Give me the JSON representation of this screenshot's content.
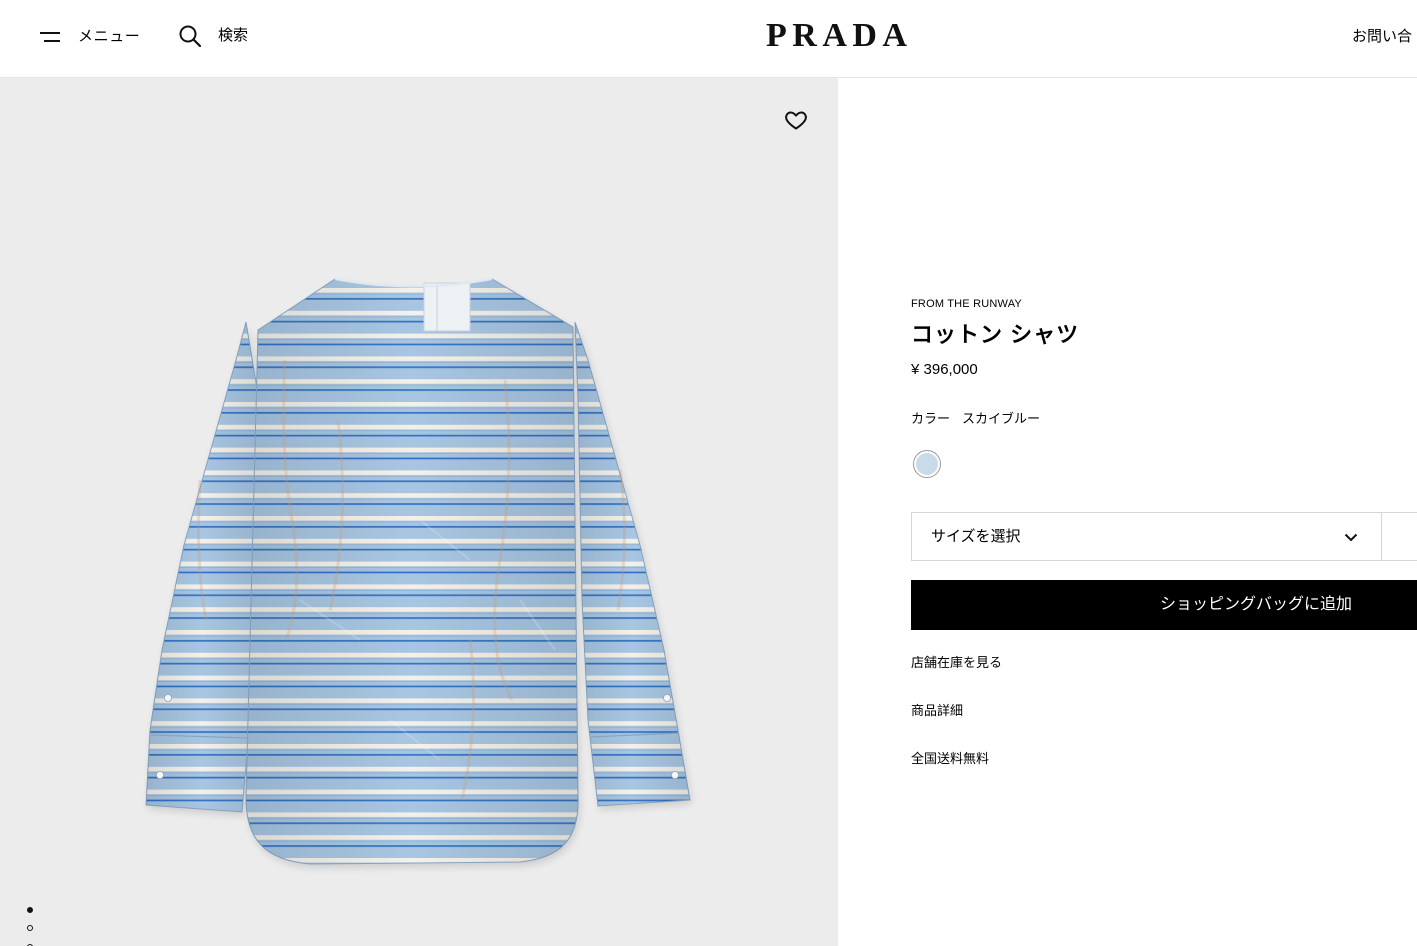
{
  "header": {
    "menu_label": "メニュー",
    "search_label": "検索",
    "logo_text": "PRADA",
    "contact_label": "お問い合"
  },
  "gallery": {
    "slide_count": 5,
    "active_slide": 1,
    "background": "#ececec",
    "shirt_colors": {
      "base": "#a8c6e2",
      "stripe_white": "#f4f0ea",
      "stripe_blue": "#3473c4"
    }
  },
  "product": {
    "collection": "FROM THE RUNWAY",
    "name": "コットン シャツ",
    "price": "¥ 396,000",
    "color_label": "カラー",
    "color_value": "スカイブルー",
    "swatch_color": "#c7dbea",
    "size_placeholder": "サイズを選択",
    "add_to_bag_label": "ショッピングバッグに追加",
    "links": [
      "店舗在庫を見る",
      "商品詳細",
      "全国送料無料"
    ]
  },
  "icons": {
    "menu": "hamburger-icon",
    "search": "search-icon",
    "wishlist": "heart-icon",
    "size_dropdown": "chevron-down-icon"
  },
  "colors": {
    "button_background": "#000000",
    "button_text": "#ffffff",
    "border": "#d6d6d6"
  }
}
